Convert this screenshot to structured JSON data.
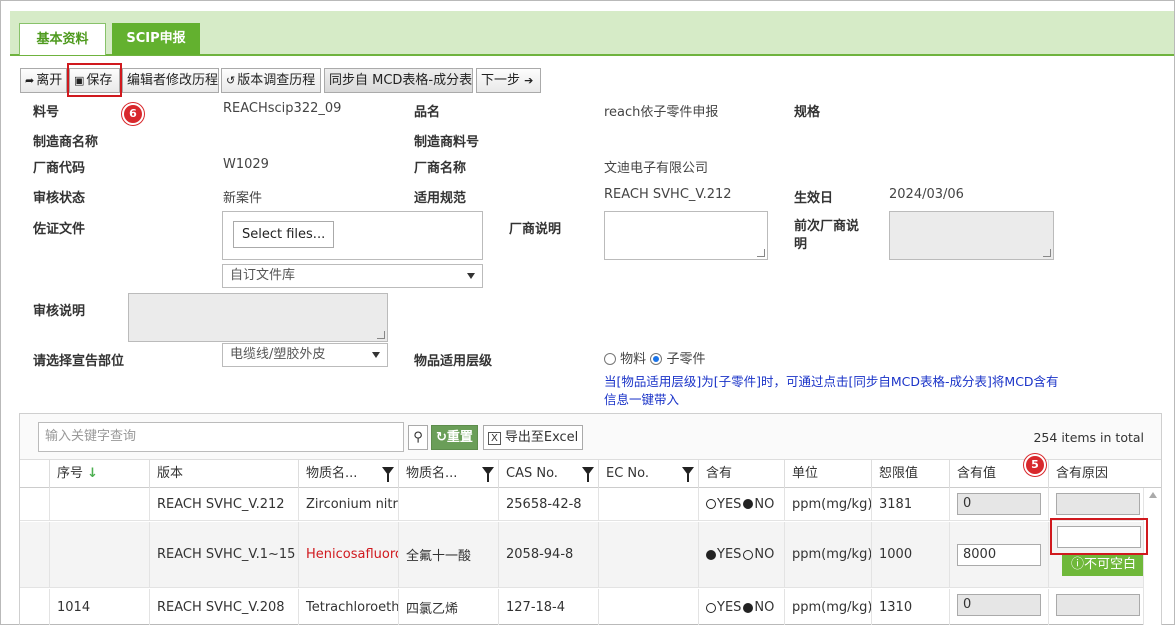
{
  "tabs": [
    {
      "label": "基本资料",
      "active": true
    },
    {
      "label": "SCIP申报",
      "active": false
    }
  ],
  "toolbar": {
    "leave": "离开",
    "save": "保存",
    "editor_history": "编辑者修改历程",
    "version_history": "版本调查历程",
    "sync_mcd": "同步自 MCD表格-成分表",
    "next": "下一步"
  },
  "badges": {
    "save": "6",
    "reason": "5"
  },
  "form": {
    "part_no_label": "料号",
    "part_no": "REACHscip322_09",
    "name_label": "品名",
    "name": "reach依子零件申报",
    "spec_label": "规格",
    "maker_label": "制造商名称",
    "maker_part_label": "制造商料号",
    "vendor_code_label": "厂商代码",
    "vendor_code": "W1029",
    "vendor_name_label": "厂商名称",
    "vendor_name": "文迪电子有限公司",
    "review_status_label": "审核状态",
    "review_status": "新案件",
    "regulation_label": "适用规范",
    "regulation": "REACH SVHC_V.212",
    "effective_label": "生效日",
    "effective": "2024/03/06",
    "evidence_label": "佐证文件",
    "select_files": "Select files...",
    "library_select": "自订文件库",
    "vendor_note_label": "厂商说明",
    "prev_vendor_note_label": "前次厂商说明",
    "review_note_label": "审核说明",
    "declare_part_label": "请选择宣告部位",
    "declare_part": "电缆线/塑胶外皮",
    "level_label": "物品适用层级",
    "level_options": [
      "物料",
      "子零件"
    ],
    "level_selected": "子零件",
    "level_note": "当[物品适用层级]为[子零件]时，可通过点击[同步自MCD表格-成分表]将MCD含有信息一键带入"
  },
  "grid": {
    "search_placeholder": "输入关键字查询",
    "reset": "重置",
    "export": "导出至Excel",
    "total": "254 items in total",
    "columns": [
      "序号",
      "版本",
      "物质名...",
      "物质名...",
      "CAS No.",
      "EC No.",
      "含有",
      "单位",
      "恕限值",
      "含有值",
      "含有原因"
    ],
    "rows": [
      {
        "seq": "",
        "version": "REACH SVHC_V.212",
        "name_en": "Zirconium nitride",
        "name_cn": "",
        "cas": "25658-42-8",
        "ec": "",
        "contains": "NO",
        "unit": "ppm(mg/kg)",
        "threshold": "3181",
        "value": "0",
        "reason": ""
      },
      {
        "seq": "",
        "version": "REACH SVHC_V.1~15",
        "name_en": "Henicosafluorou",
        "name_cn": "全氟十一酸",
        "cas": "2058-94-8",
        "ec": "",
        "contains": "YES",
        "unit": "ppm(mg/kg)",
        "threshold": "1000",
        "value": "8000",
        "reason": ""
      },
      {
        "seq": "1014",
        "version": "REACH SVHC_V.208",
        "name_en": "Tetrachloroethyl",
        "name_cn": "四氯乙烯",
        "cas": "127-18-4",
        "ec": "",
        "contains": "NO",
        "unit": "ppm(mg/kg)",
        "threshold": "1310",
        "value": "0",
        "reason": ""
      }
    ],
    "yes_label": "YES",
    "no_label": "NO",
    "required_msg": "不可空白"
  },
  "colors": {
    "accent_green": "#63b12f",
    "highlight_red": "#d0191e",
    "note_blue": "#1a33c8"
  }
}
